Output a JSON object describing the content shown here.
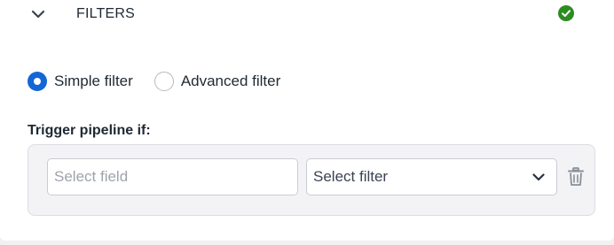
{
  "header": {
    "title": "FILTERS",
    "collapse_icon": "chevron-down-icon",
    "status_icon": "check-circle-icon",
    "status_color": "#2e8b22"
  },
  "filter_mode": {
    "options": [
      {
        "label": "Simple filter",
        "selected": true
      },
      {
        "label": "Advanced filter",
        "selected": false
      }
    ],
    "accent_color": "#1366d6"
  },
  "trigger": {
    "label": "Trigger pipeline if:",
    "field_input": {
      "placeholder": "Select field",
      "value": ""
    },
    "filter_select": {
      "value": "Select filter",
      "icon": "chevron-down-icon"
    },
    "delete_icon": "trash-icon"
  }
}
